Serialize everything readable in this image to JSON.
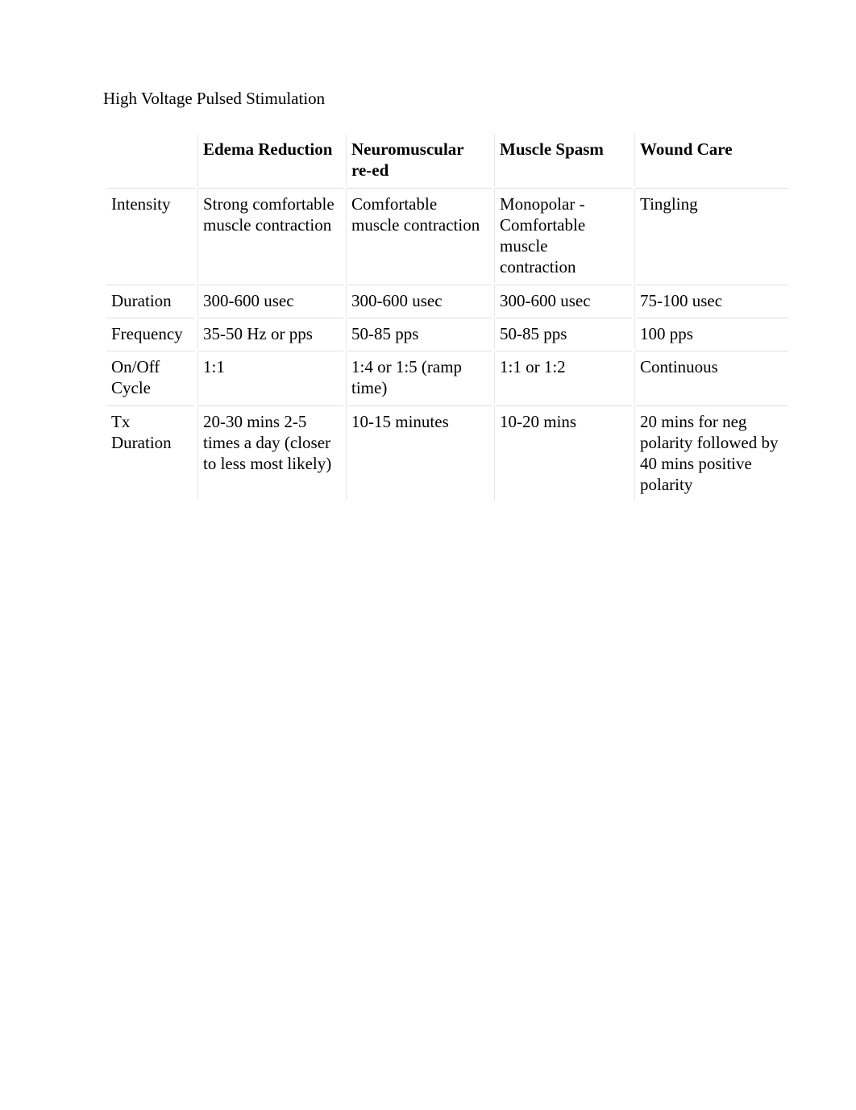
{
  "title": "High Voltage Pulsed Stimulation",
  "columns": [
    "",
    "Edema Reduction",
    "Neuromuscular re-ed",
    "Muscle Spasm",
    "Wound Care"
  ],
  "rows": [
    {
      "label": "Intensity",
      "cells": [
        "Strong comfortable muscle contraction",
        "Comfortable muscle contraction",
        "Monopolar - Comfortable muscle contraction",
        "Tingling"
      ]
    },
    {
      "label": "Duration",
      "cells": [
        "300-600 usec",
        "300-600 usec",
        "300-600 usec",
        "75-100 usec"
      ]
    },
    {
      "label": "Frequency",
      "cells": [
        "35-50 Hz or pps",
        "50-85 pps",
        "50-85 pps",
        "100 pps"
      ]
    },
    {
      "label": "On/Off Cycle",
      "cells": [
        "1:1",
        "1:4 or 1:5 (ramp time)",
        "1:1 or 1:2",
        "Continuous"
      ]
    },
    {
      "label": "Tx Duration",
      "cells": [
        "20-30 mins 2-5 times a day (closer to less most likely)",
        "10-15 minutes",
        "10-20 mins",
        "20 mins for neg polarity followed by 40 mins positive polarity"
      ]
    }
  ]
}
